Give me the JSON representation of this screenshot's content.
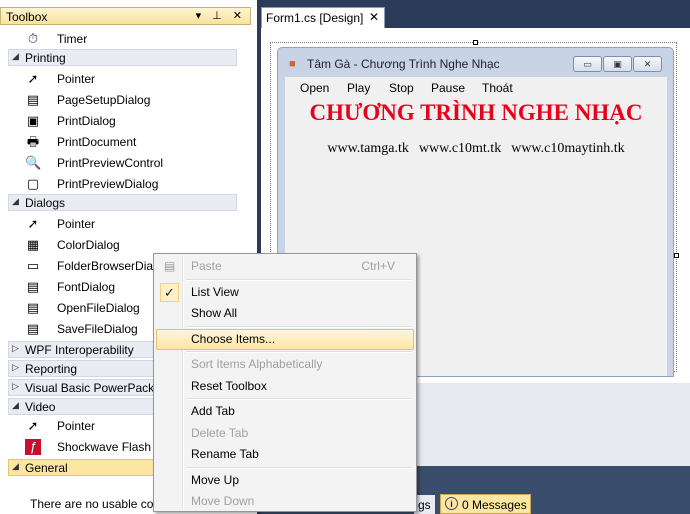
{
  "toolbox": {
    "title": "Toolbox",
    "title_buttons": "▾ ⊥ ✕",
    "items": [
      {
        "type": "item",
        "label": "Timer",
        "icon": "timer-icon",
        "glyph": "⏱"
      },
      {
        "type": "category",
        "label": "Printing",
        "arrow": "◢"
      },
      {
        "type": "item",
        "label": "Pointer",
        "icon": "pointer-icon",
        "glyph": "➚"
      },
      {
        "type": "item",
        "label": "PageSetupDialog",
        "icon": "page-setup-icon",
        "glyph": "▤"
      },
      {
        "type": "item",
        "label": "PrintDialog",
        "icon": "print-dialog-icon",
        "glyph": "▣"
      },
      {
        "type": "item",
        "label": "PrintDocument",
        "icon": "print-document-icon",
        "glyph": "🖶"
      },
      {
        "type": "item",
        "label": "PrintPreviewControl",
        "icon": "print-preview-control-icon",
        "glyph": "🔍"
      },
      {
        "type": "item",
        "label": "PrintPreviewDialog",
        "icon": "print-preview-dialog-icon",
        "glyph": "▢"
      },
      {
        "type": "category",
        "label": "Dialogs",
        "arrow": "◢"
      },
      {
        "type": "item",
        "label": "Pointer",
        "icon": "pointer-icon",
        "glyph": "➚"
      },
      {
        "type": "item",
        "label": "ColorDialog",
        "icon": "color-dialog-icon",
        "glyph": "▦"
      },
      {
        "type": "item",
        "label": "FolderBrowserDialog",
        "icon": "folder-browser-icon",
        "glyph": "▭"
      },
      {
        "type": "item",
        "label": "FontDialog",
        "icon": "font-dialog-icon",
        "glyph": "▤"
      },
      {
        "type": "item",
        "label": "OpenFileDialog",
        "icon": "open-file-dialog-icon",
        "glyph": "▤"
      },
      {
        "type": "item",
        "label": "SaveFileDialog",
        "icon": "save-file-dialog-icon",
        "glyph": "▤"
      },
      {
        "type": "category",
        "label": "WPF Interoperability",
        "arrow": "▷"
      },
      {
        "type": "category",
        "label": "Reporting",
        "arrow": "▷"
      },
      {
        "type": "category",
        "label": "Visual Basic PowerPacks",
        "arrow": "▷"
      },
      {
        "type": "category",
        "label": "Video",
        "arrow": "◢"
      },
      {
        "type": "item",
        "label": "Pointer",
        "icon": "pointer-icon",
        "glyph": "➚"
      },
      {
        "type": "item",
        "label": "Shockwave Flash Object",
        "icon": "flash-icon",
        "glyph": "ƒ"
      },
      {
        "type": "category",
        "label": "General",
        "arrow": "◢",
        "selected": true
      }
    ],
    "empty_message": "There are no usable controls in this group."
  },
  "document": {
    "tab_label": "Form1.cs [Design]",
    "close_glyph": "✕"
  },
  "form": {
    "title": "Tâm Gà - Chương Trình Nghe Nhạc",
    "window_buttons": [
      "▭",
      "▣",
      "✕"
    ],
    "menu": [
      "Open",
      "Play",
      "Stop",
      "Pause",
      "Thoát"
    ],
    "heading": "CHƯƠNG TRÌNH NGHE NHẠC",
    "sites": [
      "www.tamga.tk",
      "www.c10mt.tk",
      "www.c10maytinh.tk"
    ]
  },
  "status": {
    "tab_fragment": "gs",
    "messages_label": "0 Messages",
    "messages_icon": "i"
  },
  "context_menu": {
    "items": [
      {
        "label": "Paste",
        "shortcut": "Ctrl+V",
        "disabled": true,
        "icon": "paste-icon"
      },
      {
        "separator": true
      },
      {
        "label": "List View",
        "checked": true
      },
      {
        "label": "Show All"
      },
      {
        "separator": true
      },
      {
        "label": "Choose Items...",
        "highlighted": true
      },
      {
        "separator": true
      },
      {
        "label": "Sort Items Alphabetically",
        "disabled": true
      },
      {
        "label": "Reset Toolbox"
      },
      {
        "separator": true
      },
      {
        "label": "Add Tab"
      },
      {
        "label": "Delete Tab",
        "disabled": true
      },
      {
        "label": "Rename Tab"
      },
      {
        "separator": true
      },
      {
        "label": "Move Up"
      },
      {
        "label": "Move Down",
        "disabled": true
      }
    ]
  },
  "colors": {
    "heading_red": "#e8001c",
    "highlight_gold": "#fbe7a1",
    "ide_background": "#2b3c59"
  }
}
